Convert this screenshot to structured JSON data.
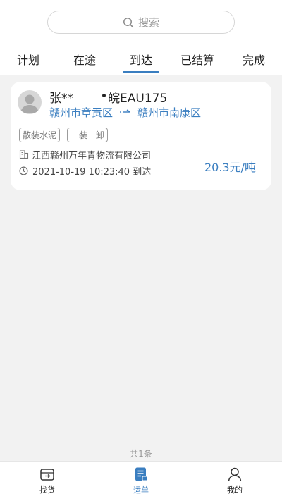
{
  "search": {
    "placeholder": "搜索"
  },
  "tabs": [
    {
      "label": "计划",
      "active": false
    },
    {
      "label": "在途",
      "active": false
    },
    {
      "label": "到达",
      "active": true
    },
    {
      "label": "已结算",
      "active": false
    },
    {
      "label": "完成",
      "active": false
    }
  ],
  "order": {
    "driver_name": "张**",
    "plate": "皖EAU175",
    "origin": "赣州市章贡区",
    "destination": "赣州市南康区",
    "tags": [
      "散装水泥",
      "一装一卸"
    ],
    "company": "江西赣州万年青物流有限公司",
    "time": "2021-10-19 10:23:40 到达",
    "price": "20.3元/吨"
  },
  "summary": {
    "total": "共1条"
  },
  "bottom_nav": [
    {
      "label": "找货",
      "icon": "find-goods-icon",
      "active": false
    },
    {
      "label": "运单",
      "icon": "waybill-icon",
      "active": true
    },
    {
      "label": "我的",
      "icon": "profile-icon",
      "active": false
    }
  ],
  "colors": {
    "accent": "#3a7ec0",
    "background": "#f2f2f2"
  }
}
